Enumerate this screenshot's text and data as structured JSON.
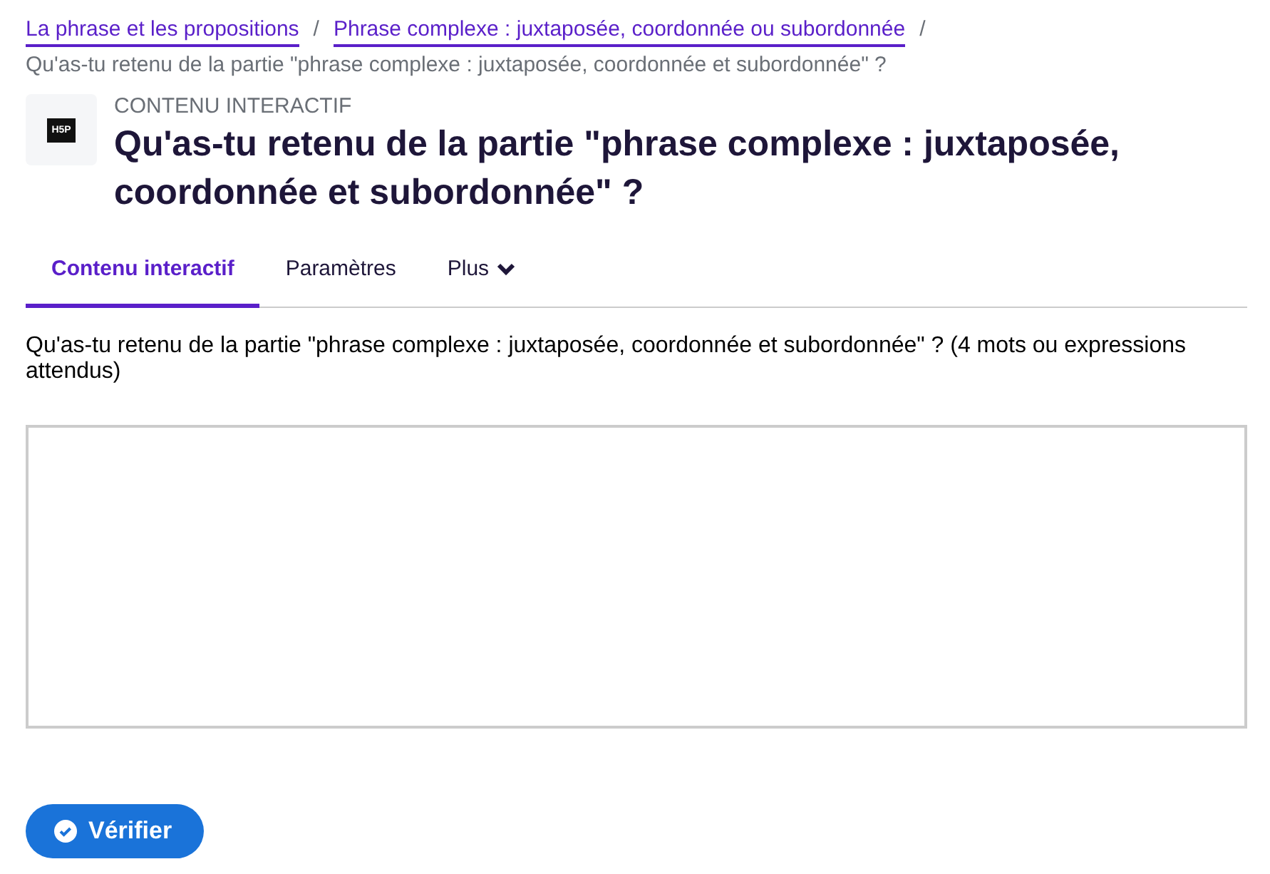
{
  "breadcrumbs": [
    {
      "label": "La phrase et les propositions",
      "kind": "link"
    },
    {
      "separator": "/",
      "label": "Phrase complexe : juxtaposée, coordonnée ou subordonnée",
      "kind": "link"
    },
    {
      "separator": "/",
      "label": "Qu'as-tu retenu de la partie \"phrase complexe : juxtaposée, coordonnée et subordonnée\" ?",
      "kind": "current"
    }
  ],
  "header": {
    "logo_text": "H5P",
    "eyebrow": "CONTENU INTERACTIF",
    "title": "Qu'as-tu retenu de la partie \"phrase complexe : juxtaposée, coordonnée et subordonnée\" ?"
  },
  "tabs": [
    {
      "label": "Contenu interactif",
      "selected": true,
      "dropdown": false
    },
    {
      "label": "Paramètres",
      "selected": false,
      "dropdown": false
    },
    {
      "label": "Plus",
      "selected": false,
      "dropdown": true
    }
  ],
  "question": {
    "text": "Qu'as-tu retenu de la partie \"phrase complexe : juxtaposée, coordonnée et subordonnée\" ? (4 mots ou expressions attendus)"
  },
  "check_button": {
    "label": "Vérifier"
  }
}
